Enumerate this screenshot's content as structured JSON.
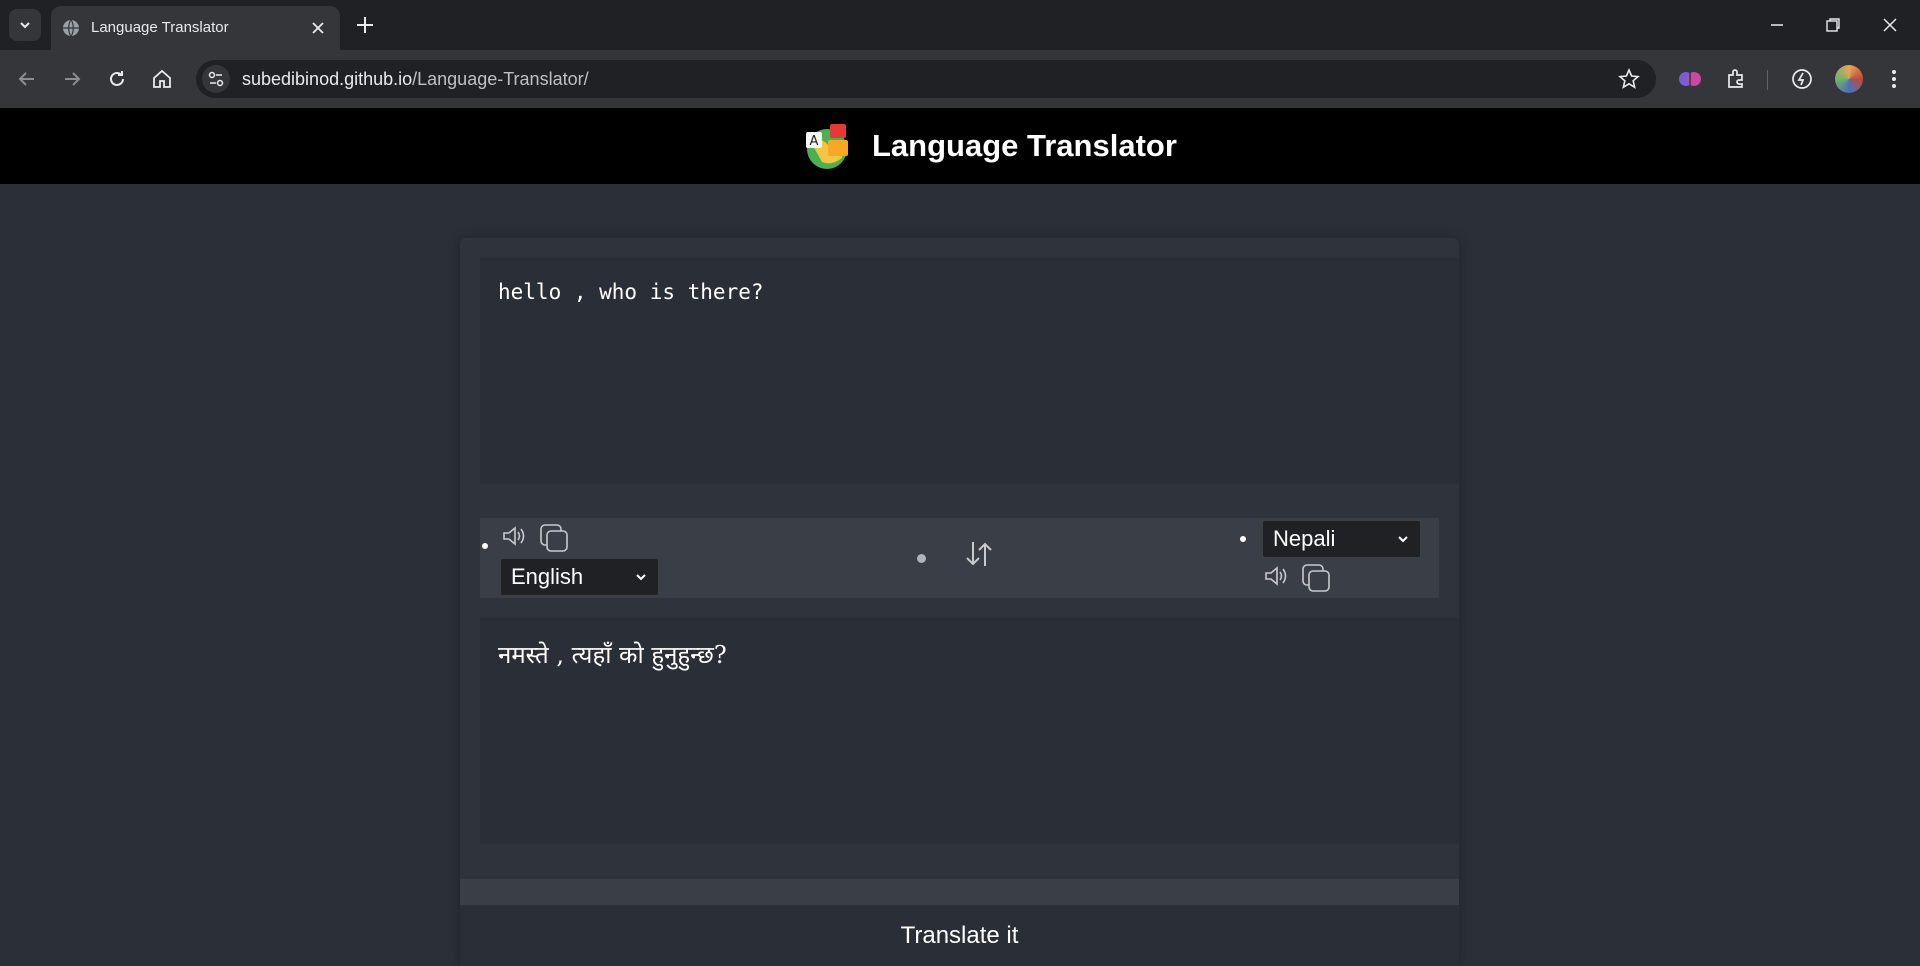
{
  "browser": {
    "tab": {
      "title": "Language Translator"
    },
    "url": {
      "host": "subedibinod.github.io",
      "path": "/Language-Translator/"
    }
  },
  "page": {
    "site_title": "Language Translator",
    "from": {
      "text": "hello , who is there?",
      "language": "English"
    },
    "to": {
      "text": "नमस्ते , त्यहाँ को हुनुहुन्छ?",
      "language": "Nepali"
    },
    "translate_button": "Translate it"
  }
}
